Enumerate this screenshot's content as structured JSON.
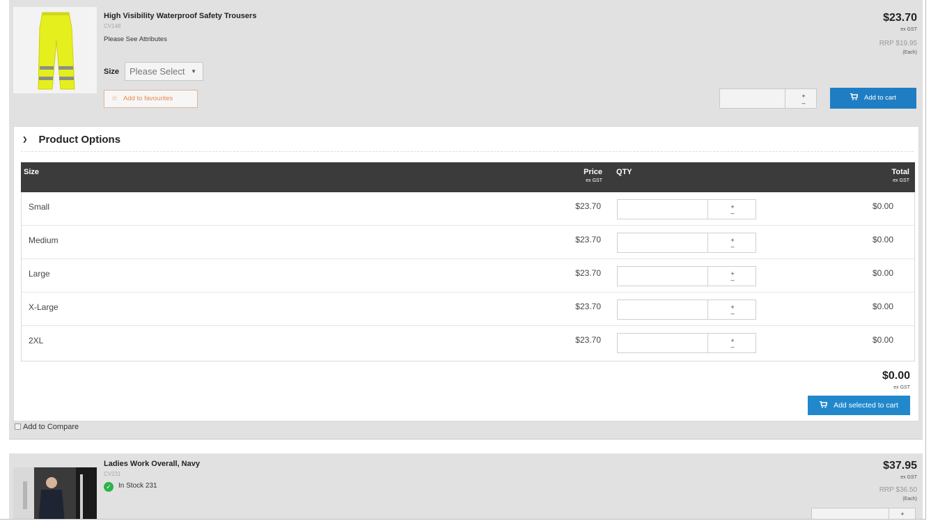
{
  "product1": {
    "title": "High Visibility Waterproof Safety Trousers",
    "code": "CV148",
    "attributes_text": "Please See Attributes",
    "size_label": "Size",
    "size_select_value": "Please Select",
    "favourite_label": "Add to favourites",
    "price": "$23.70",
    "price_tax_note": "ex GST",
    "rrp": "RRP $19.95",
    "unit": "(Each)",
    "add_to_cart_label": "Add to cart"
  },
  "options": {
    "heading": "Product Options",
    "columns": {
      "size": "Size",
      "price": "Price",
      "price_sub": "ex GST",
      "qty": "QTY",
      "total": "Total",
      "total_sub": "ex GST"
    },
    "rows": [
      {
        "size": "Small",
        "price": "$23.70",
        "total": "$0.00"
      },
      {
        "size": "Medium",
        "price": "$23.70",
        "total": "$0.00"
      },
      {
        "size": "Large",
        "price": "$23.70",
        "total": "$0.00"
      },
      {
        "size": "X-Large",
        "price": "$23.70",
        "total": "$0.00"
      },
      {
        "size": "2XL",
        "price": "$23.70",
        "total": "$0.00"
      }
    ],
    "grand_total": "$0.00",
    "grand_total_note": "ex GST",
    "add_selected_label": "Add selected to cart"
  },
  "compare_label": "Add to Compare",
  "product2": {
    "title": "Ladies Work Overall, Navy",
    "code": "CV231",
    "stock_text": "In Stock 231",
    "price": "$37.95",
    "price_tax_note": "ex GST",
    "rrp": "RRP $36.50",
    "unit": "(Each)"
  },
  "colors": {
    "accent_blue": "#1f7ec3",
    "favourite_orange": "#e78a4e",
    "table_header": "#3b3b3b",
    "stock_green": "#2db24a"
  }
}
